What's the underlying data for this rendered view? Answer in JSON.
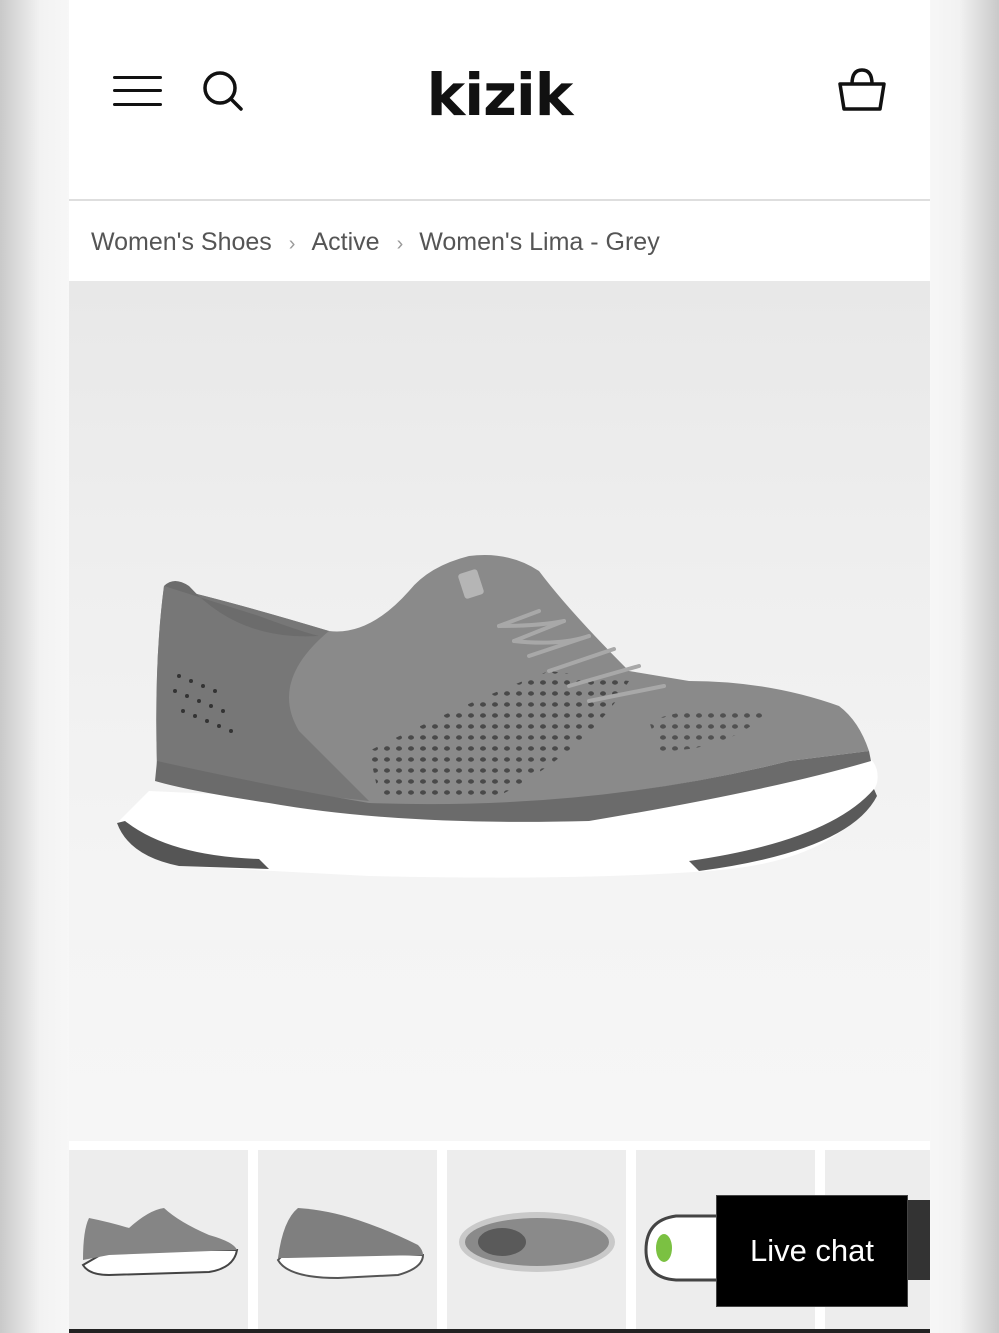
{
  "header": {
    "brand": "kizik"
  },
  "breadcrumb": {
    "items": [
      "Women's Shoes",
      "Active",
      "Women's Lima - Grey"
    ],
    "separator": "›"
  },
  "live_chat": {
    "label": "Live chat"
  },
  "icons": {
    "menu": "hamburger-menu-icon",
    "search": "search-icon",
    "cart": "basket-icon"
  },
  "colors": {
    "shoe_grey": "#8a8a8a",
    "sole_white": "#ffffff",
    "chat_bg": "#000000"
  }
}
